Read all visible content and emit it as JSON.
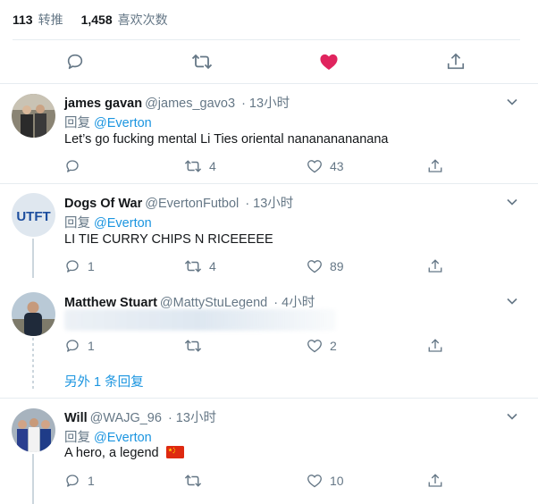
{
  "stats": {
    "retweets_num": "113",
    "retweets_label": "转推",
    "likes_num": "1,458",
    "likes_label": "喜欢次数"
  },
  "reply_prefix": "回复",
  "tweets": [
    {
      "name": "james gavan",
      "handle": "@james_gavo3",
      "time": "· 13小时",
      "reply_to": "@Everton",
      "text": "Let’s go fucking mental Li Ties oriental nanananananana",
      "retweets": "4",
      "likes": "43",
      "replies": ""
    },
    {
      "name": "Dogs Of War",
      "handle": "@EvertonFutbol",
      "time": "· 13小时",
      "reply_to": "@Everton",
      "text": "LI TIE CURRY CHIPS N RICEEEEE",
      "avatar_text": "UTFT",
      "replies": "1",
      "retweets": "4",
      "likes": "89"
    },
    {
      "name": "Matthew Stuart",
      "handle": "@MattyStuLegend",
      "time": "· 4小时",
      "replies": "1",
      "retweets": "",
      "likes": "2",
      "show_more": "另外 1 条回复"
    },
    {
      "name": "Will",
      "handle": "@WAJG_96",
      "time": "· 13小时",
      "reply_to": "@Everton",
      "text": "A hero, a legend",
      "flag_icon": "china-flag-icon",
      "replies": "1",
      "retweets": "",
      "likes": "10"
    }
  ],
  "colors": {
    "accent": "#1b95e0",
    "muted": "#657786",
    "liked": "#e0245e",
    "border": "#e6ecf0"
  }
}
